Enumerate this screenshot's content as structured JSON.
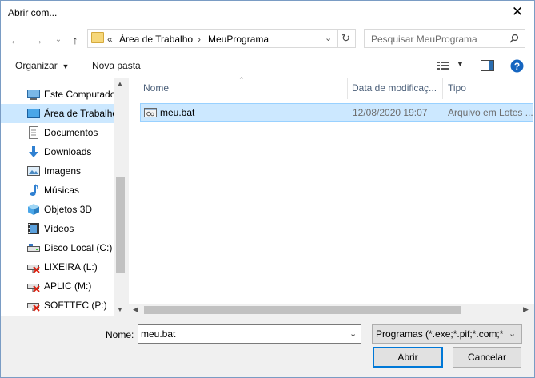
{
  "window": {
    "title": "Abrir com..."
  },
  "nav": {
    "back": "←",
    "forward": "→",
    "recent": "⌄",
    "up": "↑"
  },
  "address": {
    "overflow": "«",
    "crumbs": [
      "Área de Trabalho",
      "MeuPrograma"
    ],
    "separator": "›"
  },
  "search": {
    "placeholder": "Pesquisar MeuPrograma"
  },
  "toolbar": {
    "organize_label": "Organizar",
    "new_folder_label": "Nova pasta"
  },
  "sidebar": {
    "items": [
      {
        "label": "Este Computador",
        "icon": "computer-icon"
      },
      {
        "label": "Área de Trabalho",
        "icon": "desktop-icon",
        "selected": true
      },
      {
        "label": "Documentos",
        "icon": "documents-icon"
      },
      {
        "label": "Downloads",
        "icon": "downloads-icon"
      },
      {
        "label": "Imagens",
        "icon": "pictures-icon"
      },
      {
        "label": "Músicas",
        "icon": "music-icon"
      },
      {
        "label": "Objetos 3D",
        "icon": "objects3d-icon"
      },
      {
        "label": "Vídeos",
        "icon": "videos-icon"
      },
      {
        "label": "Disco Local (C:)",
        "icon": "local-disk-icon"
      },
      {
        "label": "LIXEIRA (L:)",
        "icon": "network-drive-disconnected-icon"
      },
      {
        "label": "APLIC (M:)",
        "icon": "network-drive-disconnected-icon"
      },
      {
        "label": "SOFTTEC (P:)",
        "icon": "network-drive-disconnected-icon"
      }
    ]
  },
  "file_list": {
    "columns": [
      "Nome",
      "Data de modificaç...",
      "Tipo"
    ],
    "rows": [
      {
        "name": "meu.bat",
        "modified": "12/08/2020 19:07",
        "type": "Arquivo em Lotes ..."
      }
    ]
  },
  "footer": {
    "name_label": "Nome:",
    "name_value": "meu.bat",
    "filter_value": "Programas (*.exe;*.pif;*.com;*.ba",
    "open_label": "Abrir",
    "cancel_label": "Cancelar"
  },
  "colors": {
    "selection": "#cce8ff",
    "accent": "#0078d7",
    "help": "#1565c0"
  }
}
